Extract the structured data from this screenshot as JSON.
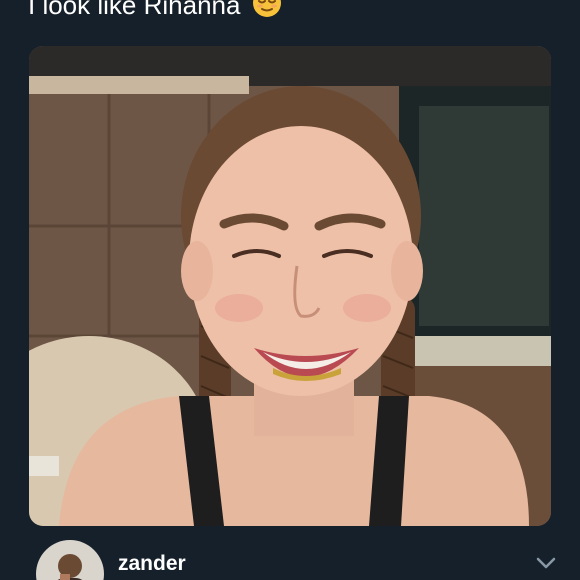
{
  "tweet": {
    "text": "I look like Rihanna",
    "emoji_icon": "relieved-face-icon"
  },
  "media": {
    "icon": "photo-of-smiling-woman-with-braids-and-gold-grill"
  },
  "user": {
    "username": "zander",
    "avatar_icon": "avatar-icon",
    "menu_icon": "chevron-down-icon"
  },
  "colors": {
    "background": "#15202b",
    "text": "#ffffff",
    "muted": "#8899a6"
  }
}
